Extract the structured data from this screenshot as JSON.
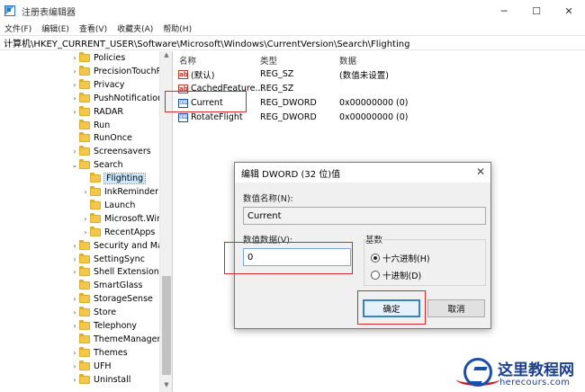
{
  "window": {
    "title": "注册表编辑器",
    "min_glyph": "─",
    "max_glyph": "☐",
    "close_glyph": "✕"
  },
  "menu": [
    {
      "label": "文件(F)"
    },
    {
      "label": "编辑(E)"
    },
    {
      "label": "查看(V)"
    },
    {
      "label": "收藏夹(A)"
    },
    {
      "label": "帮助(H)"
    }
  ],
  "address": "计算机\\HKEY_CURRENT_USER\\Software\\Microsoft\\Windows\\CurrentVersion\\Search\\Flighting",
  "tree": [
    {
      "label": "Policies",
      "chev": "›"
    },
    {
      "label": "PrecisionTouchPa",
      "chev": "›"
    },
    {
      "label": "Privacy",
      "chev": "›"
    },
    {
      "label": "PushNotifications",
      "chev": "›"
    },
    {
      "label": "RADAR",
      "chev": "›"
    },
    {
      "label": "Run",
      "chev": ""
    },
    {
      "label": "RunOnce",
      "chev": ""
    },
    {
      "label": "Screensavers",
      "chev": "›"
    },
    {
      "label": "Search",
      "chev": "⌄"
    },
    {
      "label": "Flighting",
      "chev": "",
      "selected": true
    },
    {
      "label": "InkReminder",
      "chev": "›"
    },
    {
      "label": "Launch",
      "chev": ""
    },
    {
      "label": "Microsoft.Wind",
      "chev": "›"
    },
    {
      "label": "RecentApps",
      "chev": "›"
    },
    {
      "label": "Security and Main",
      "chev": "›"
    },
    {
      "label": "SettingSync",
      "chev": "›"
    },
    {
      "label": "Shell Extensions",
      "chev": "›"
    },
    {
      "label": "SmartGlass",
      "chev": ""
    },
    {
      "label": "StorageSense",
      "chev": "›"
    },
    {
      "label": "Store",
      "chev": "›"
    },
    {
      "label": "Telephony",
      "chev": "›"
    },
    {
      "label": "ThemeManager",
      "chev": ""
    },
    {
      "label": "Themes",
      "chev": "›"
    },
    {
      "label": "UFH",
      "chev": "›"
    },
    {
      "label": "Uninstall",
      "chev": "›"
    }
  ],
  "columns": {
    "name": "名称",
    "type": "类型",
    "data": "数据"
  },
  "values": [
    {
      "icon": "string-value-icon",
      "name": "(默认)",
      "type": "REG_SZ",
      "data": "(数值未设置)"
    },
    {
      "icon": "string-value-icon",
      "name": "CachedFeature...",
      "type": "REG_SZ",
      "data": ""
    },
    {
      "icon": "dword-value-icon",
      "name": "Current",
      "type": "REG_DWORD",
      "data": "0x00000000 (0)"
    },
    {
      "icon": "dword-value-icon",
      "name": "RotateFlight",
      "type": "REG_DWORD",
      "data": "0x00000000 (0)"
    }
  ],
  "dialog": {
    "title": "编辑 DWORD (32 位)值",
    "name_label": "数值名称(N):",
    "name_value": "Current",
    "data_label": "数值数据(V):",
    "data_value": "0",
    "base_label": "基数",
    "hex_label": "十六进制(H)",
    "dec_label": "十进制(D)",
    "selected_base": "hex",
    "ok_label": "确定",
    "cancel_label": "取消"
  },
  "watermark": {
    "cn": "这里教程网",
    "en": "herecours.com"
  },
  "colors": {
    "highlight_box": "#d02b2b",
    "selection": "#cce8ff",
    "folder": "#f3c84a"
  }
}
